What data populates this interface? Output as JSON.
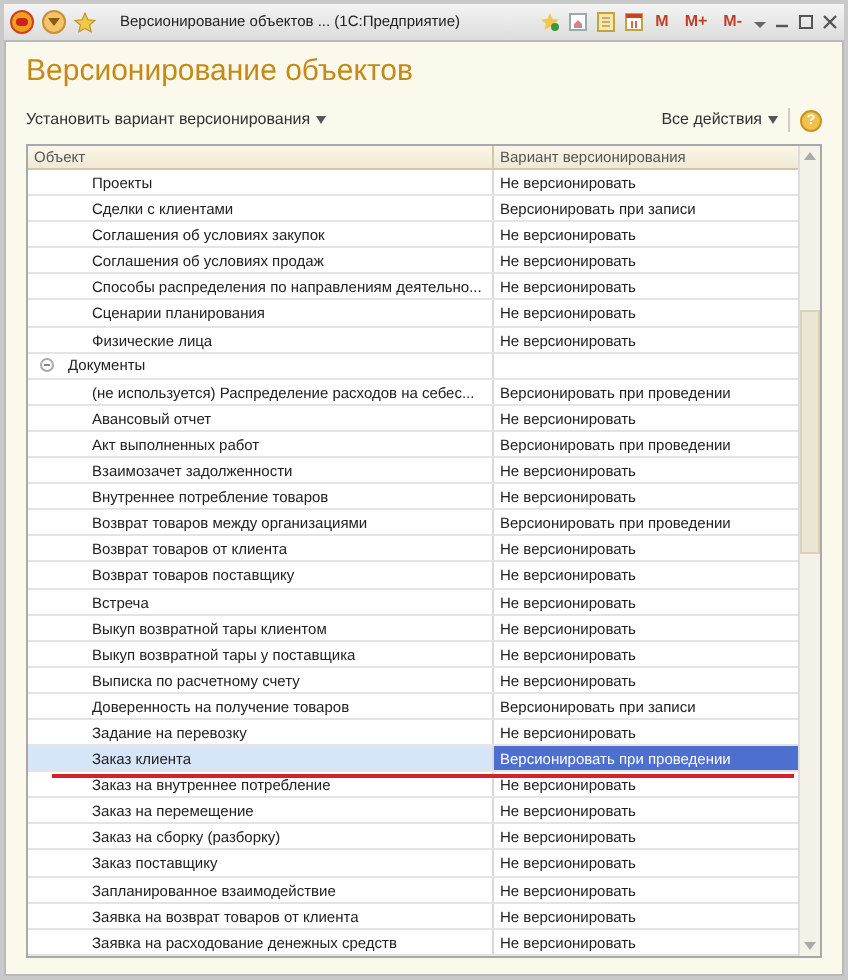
{
  "window": {
    "title": "Версионирование объектов ... (1С:Предприятие)",
    "memory_buttons": [
      "M",
      "M+",
      "M-"
    ]
  },
  "form": {
    "title": "Версионирование объектов"
  },
  "toolbar": {
    "set_variant": "Установить вариант версионирования",
    "all_actions": "Все действия",
    "help": "?"
  },
  "table": {
    "columns": [
      "Объект",
      "Вариант версионирования"
    ],
    "tree": [
      {
        "kind": "continued",
        "children": [
          {
            "object": "Проекты",
            "variant": "Не версионировать",
            "selected": false
          },
          {
            "object": "Сделки с клиентами",
            "variant": "Версионировать при записи",
            "selected": false
          },
          {
            "object": "Соглашения об условиях закупок",
            "variant": "Не версионировать",
            "selected": false
          },
          {
            "object": "Соглашения об условиях продаж",
            "variant": "Не версионировать",
            "selected": false
          },
          {
            "object": "Способы распределения по направлениям деятельно...",
            "variant": "Не версионировать",
            "selected": false
          },
          {
            "object": "Сценарии планирования",
            "variant": "Не версионировать",
            "selected": false
          },
          {
            "object": "Физические лица",
            "variant": "Не версионировать",
            "selected": false
          }
        ]
      },
      {
        "kind": "group",
        "object": "Документы",
        "expanded": true,
        "children": [
          {
            "object": "(не используется) Распределение расходов на себес...",
            "variant": "Версионировать при проведении",
            "selected": false
          },
          {
            "object": "Авансовый отчет",
            "variant": "Не версионировать",
            "selected": false
          },
          {
            "object": "Акт выполненных работ",
            "variant": "Версионировать при проведении",
            "selected": false
          },
          {
            "object": "Взаимозачет задолженности",
            "variant": "Не версионировать",
            "selected": false
          },
          {
            "object": "Внутреннее потребление товаров",
            "variant": "Не версионировать",
            "selected": false
          },
          {
            "object": "Возврат товаров между организациями",
            "variant": "Версионировать при проведении",
            "selected": false
          },
          {
            "object": "Возврат товаров от клиента",
            "variant": "Не версионировать",
            "selected": false
          },
          {
            "object": "Возврат товаров поставщику",
            "variant": "Не версионировать",
            "selected": false
          },
          {
            "object": "Встреча",
            "variant": "Не версионировать",
            "selected": false
          },
          {
            "object": "Выкуп возвратной тары клиентом",
            "variant": "Не версионировать",
            "selected": false
          },
          {
            "object": "Выкуп возвратной тары у поставщика",
            "variant": "Не версионировать",
            "selected": false
          },
          {
            "object": "Выписка по расчетному счету",
            "variant": "Не версионировать",
            "selected": false
          },
          {
            "object": "Доверенность на получение товаров",
            "variant": "Версионировать при записи",
            "selected": false
          },
          {
            "object": "Задание на перевозку",
            "variant": "Не версионировать",
            "selected": false
          },
          {
            "object": "Заказ клиента",
            "variant": "Версионировать при проведении",
            "selected": true
          },
          {
            "object": "Заказ на внутреннее потребление",
            "variant": "Не версионировать",
            "selected": false
          },
          {
            "object": "Заказ на перемещение",
            "variant": "Не версионировать",
            "selected": false
          },
          {
            "object": "Заказ на сборку (разборку)",
            "variant": "Не версионировать",
            "selected": false
          },
          {
            "object": "Заказ поставщику",
            "variant": "Не версионировать",
            "selected": false
          },
          {
            "object": "Запланированное взаимодействие",
            "variant": "Не версионировать",
            "selected": false
          },
          {
            "object": "Заявка на возврат товаров от клиента",
            "variant": "Не версионировать",
            "selected": false
          },
          {
            "object": "Заявка на расходование денежных средств",
            "variant": "Не версионировать",
            "selected": false
          }
        ]
      }
    ]
  }
}
